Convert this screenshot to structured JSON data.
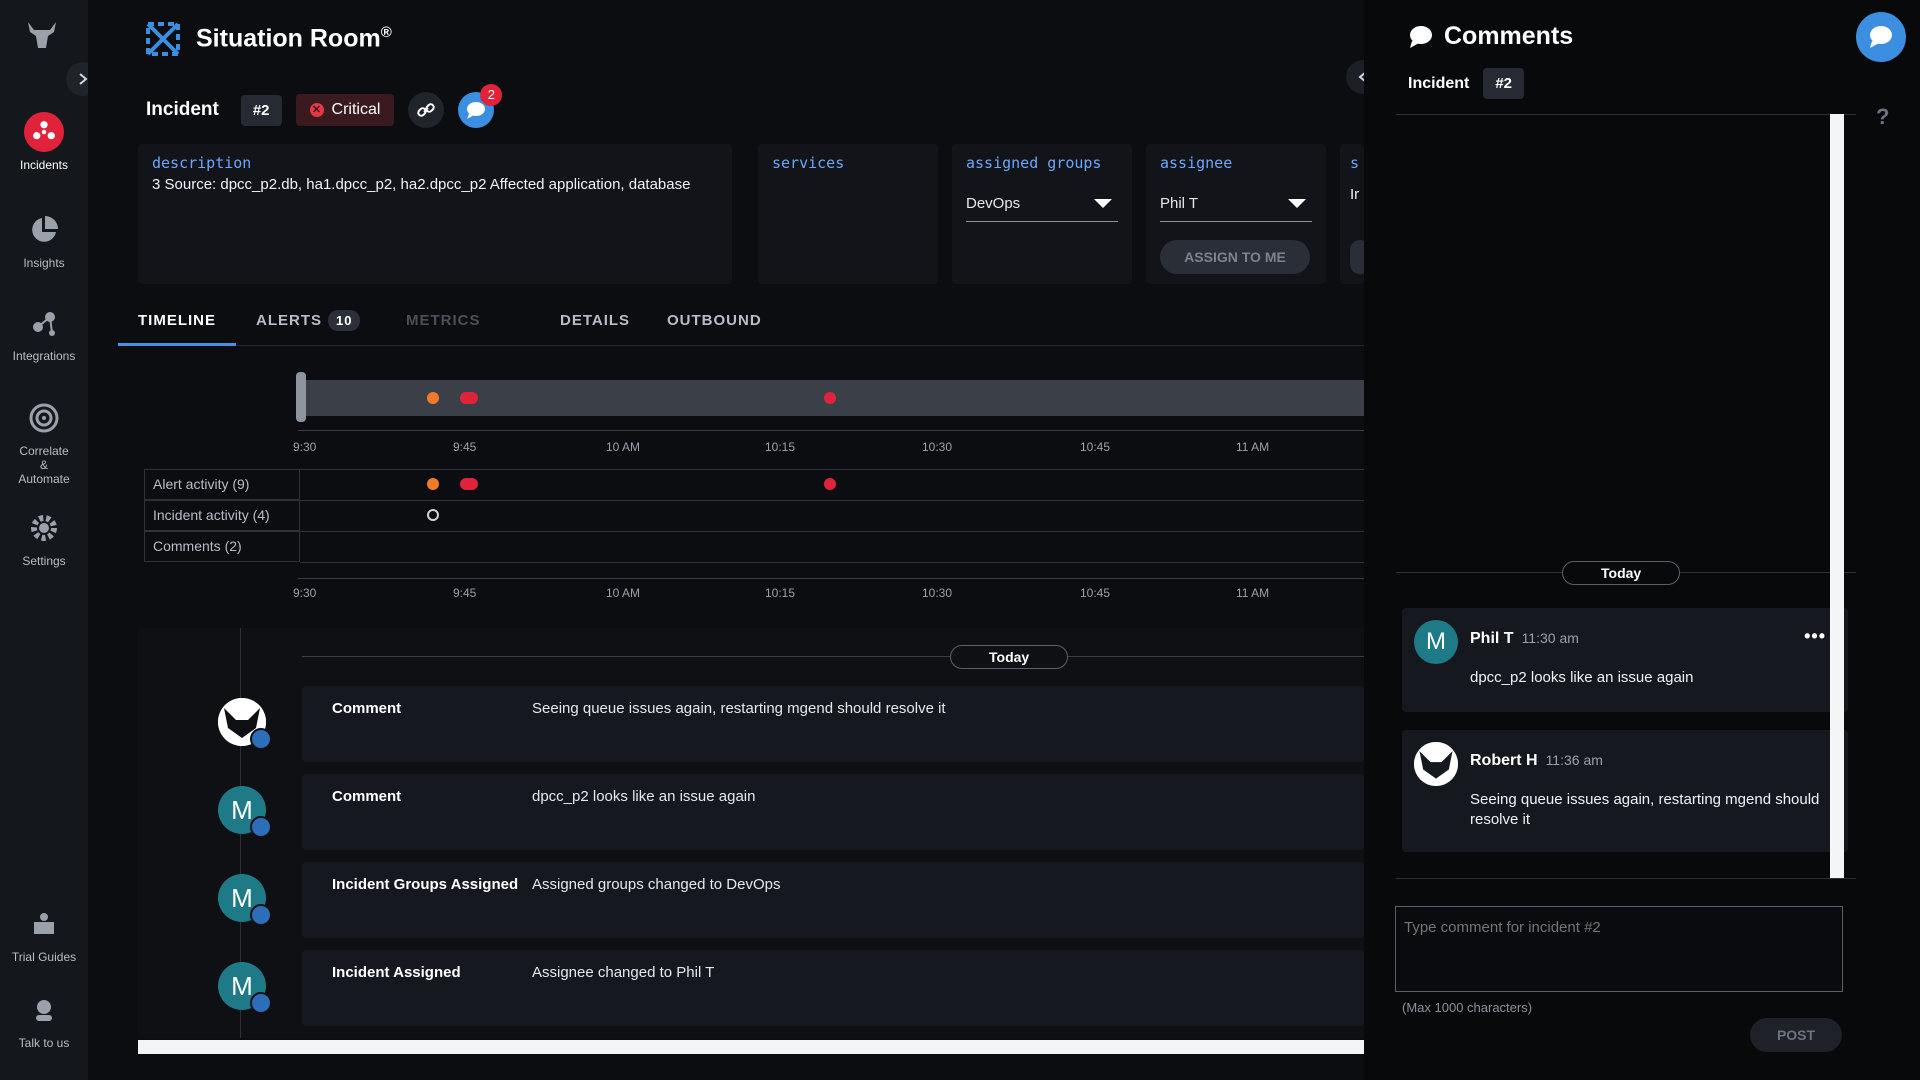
{
  "nav": {
    "items": [
      {
        "label": "Incidents",
        "icon": "incidents-icon",
        "active": true
      },
      {
        "label": "Insights",
        "icon": "pie-chart-icon"
      },
      {
        "label": "Integrations",
        "icon": "integrations-icon"
      },
      {
        "label": "Correlate & Automate",
        "icon": "target-icon"
      },
      {
        "label": "Settings",
        "icon": "gear-icon"
      },
      {
        "label": "Trial Guides",
        "icon": "book-icon"
      },
      {
        "label": "Talk to us",
        "icon": "headset-icon"
      }
    ]
  },
  "header": {
    "title": "Situation Room",
    "trademark": "®"
  },
  "incident": {
    "label": "Incident",
    "id": "#2",
    "severity": "Critical",
    "comment_badge": "2",
    "fields": {
      "description_label": "description",
      "description": "3 Source: dpcc_p2.db, ha1.dpcc_p2, ha2.dpcc_p2 Affected application, database",
      "services_label": "services",
      "assigned_groups_label": "assigned groups",
      "assigned_groups_value": "DevOps",
      "assignee_label": "assignee",
      "assignee_value": "Phil T",
      "assign_to_me": "ASSIGN TO ME",
      "cut_label": "s",
      "cut_value": "Ir"
    }
  },
  "tabs": [
    {
      "label": "TIMELINE",
      "active": true
    },
    {
      "label": "ALERTS",
      "count": "10"
    },
    {
      "label": "METRICS",
      "disabled": true
    },
    {
      "label": "DETAILS"
    },
    {
      "label": "OUTBOUND"
    }
  ],
  "timeline": {
    "ticks": [
      "9:30",
      "9:45",
      "10 AM",
      "10:15",
      "10:30",
      "10:45",
      "11 AM"
    ],
    "rows": [
      "Alert activity (9)",
      "Incident activity (4)",
      "Comments (2)"
    ]
  },
  "feed": {
    "today": "Today",
    "items": [
      {
        "type": "Comment",
        "text": "Seeing queue issues again, restarting mgend should resolve it",
        "avatar": ""
      },
      {
        "type": "Comment",
        "text": "dpcc_p2 looks like an issue again",
        "avatar": "M"
      },
      {
        "type": "Incident Groups Assigned",
        "text": "Assigned groups changed to DevOps",
        "avatar": "M"
      },
      {
        "type": "Incident Assigned",
        "text": "Assignee changed to Phil T",
        "avatar": "M"
      }
    ]
  },
  "comments": {
    "title": "Comments",
    "incident_label": "Incident",
    "incident_id": "#2",
    "today": "Today",
    "items": [
      {
        "author": "Phil T",
        "time": "11:30 am",
        "text": "dpcc_p2 looks like an issue again",
        "avatar": "M"
      },
      {
        "author": "Robert H",
        "time": "11:36 am",
        "text": "Seeing queue issues again, restarting mgend should resolve it",
        "avatar": ""
      }
    ],
    "input_placeholder": "Type comment for incident #2",
    "max_chars": "(Max 1000 characters)",
    "post": "POST",
    "help": "?"
  },
  "colors": {
    "accent": "#4a90e2",
    "critical": "#e53945",
    "alert_orange": "#f07a2a",
    "alert_red": "#e0233a"
  }
}
